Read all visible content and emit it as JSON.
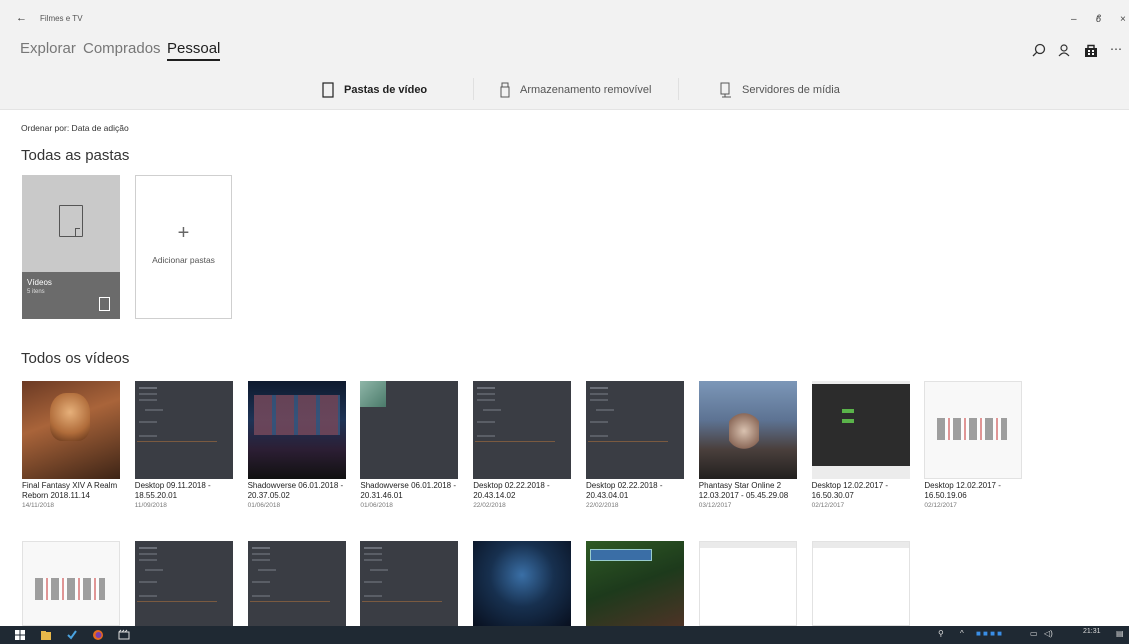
{
  "window": {
    "app_title": "Filmes e TV",
    "back_icon": "←",
    "minimize": "–",
    "restore": "ϐ",
    "close": "×"
  },
  "pivot": {
    "tabs": [
      {
        "label": "Explorar"
      },
      {
        "label": "Comprados"
      },
      {
        "label": "Pessoal"
      }
    ],
    "active": "Pessoal",
    "more": "⋯"
  },
  "subnav": {
    "items": [
      {
        "label": "Pastas de vídeo",
        "icon": "folder-icon"
      },
      {
        "label": "Armazenamento removível",
        "icon": "usb-drive-icon"
      },
      {
        "label": "Servidores de mídia",
        "icon": "media-server-icon"
      }
    ],
    "active": "Pastas de vídeo"
  },
  "sort_label": "Ordenar por: Data de adição",
  "folders_title": "Todas as pastas",
  "folders": [
    {
      "name": "Vídeos",
      "count": "5 itens"
    },
    {
      "name": "Adicionar pastas",
      "icon_text": "+"
    }
  ],
  "videos_title": "Todos os vídeos",
  "videos": [
    {
      "title": "Final Fantasy XIV  A Realm Reborn 2018.11.14",
      "date": "14/11/2018",
      "thumb": "ff"
    },
    {
      "title": "Desktop 09.11.2018 - 18.55.20.01",
      "date": "11/09/2018",
      "thumb": "dark"
    },
    {
      "title": "Shadowverse 06.01.2018 - 20.37.05.02",
      "date": "01/06/2018",
      "thumb": "sv1"
    },
    {
      "title": "Shadowverse 06.01.2018 - 20.31.46.01",
      "date": "01/06/2018",
      "thumb": "sv2"
    },
    {
      "title": "Desktop 02.22.2018 - 20.43.14.02",
      "date": "22/02/2018",
      "thumb": "dark"
    },
    {
      "title": "Desktop 02.22.2018 - 20.43.04.01",
      "date": "22/02/2018",
      "thumb": "dark"
    },
    {
      "title": "Phantasy Star Online 2 12.03.2017 - 05.45.29.08",
      "date": "03/12/2017",
      "thumb": "pso"
    },
    {
      "title": "Desktop 12.02.2017 - 16.50.30.07",
      "date": "02/12/2017",
      "thumb": "desk-dark"
    },
    {
      "title": "Desktop 12.02.2017 - 16.50.19.06",
      "date": "02/12/2017",
      "thumb": "desk-light"
    }
  ],
  "videos_row2": [
    {
      "thumb": "desk-light"
    },
    {
      "thumb": "dark"
    },
    {
      "thumb": "dark"
    },
    {
      "thumb": "dark"
    },
    {
      "thumb": "game1"
    },
    {
      "thumb": "game2"
    },
    {
      "thumb": "blank"
    },
    {
      "thumb": "blank"
    }
  ],
  "taskbar": {
    "time": "21:31",
    "apps": [
      "windows-start-icon",
      "file-explorer-icon",
      "tasks-icon",
      "firefox-icon",
      "film-icon"
    ]
  }
}
